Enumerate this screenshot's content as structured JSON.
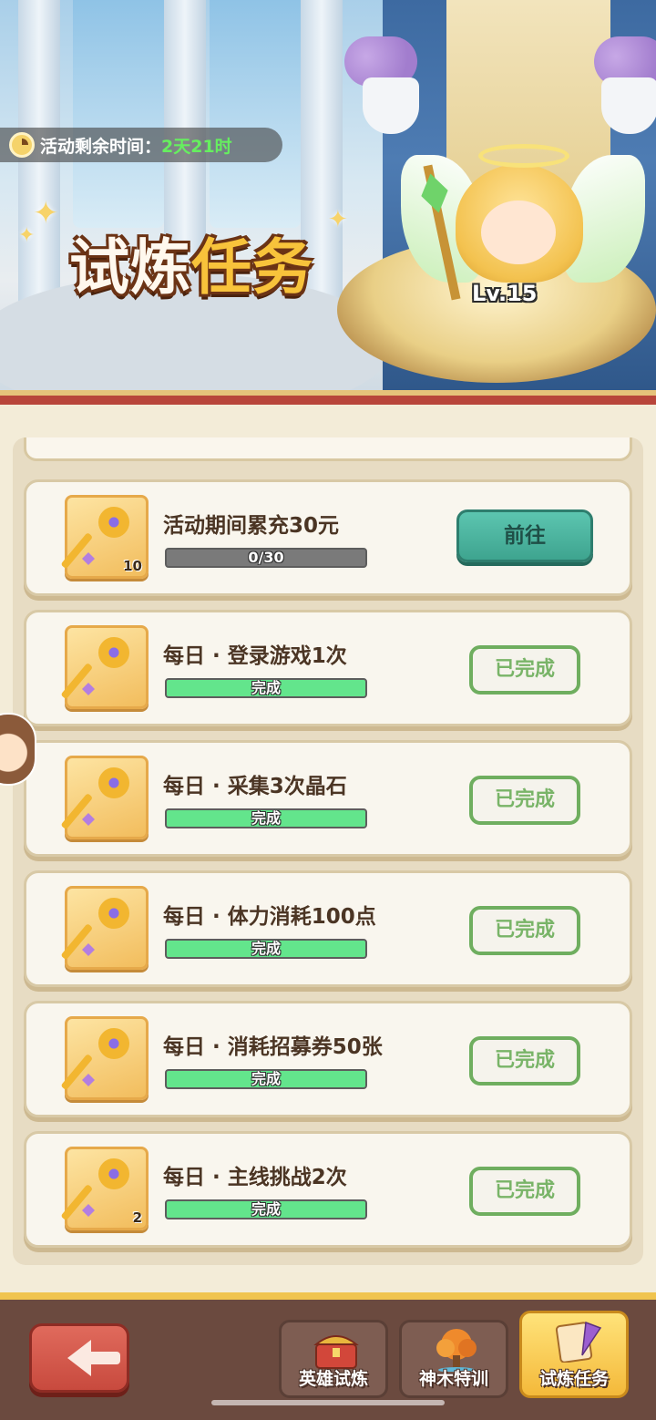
{
  "banner": {
    "timer_label": "活动剩余时间：",
    "timer_value": "2天21时",
    "title_part1": "试炼",
    "title_part2": "任务",
    "hero_level": "Lv.15"
  },
  "tasks": [
    {
      "name": "活动期间累充30元",
      "progress_text": "0/30",
      "progress": 0,
      "count": "10",
      "button": "前往",
      "state": "go"
    },
    {
      "name": "每日 · 登录游戏1次",
      "progress_text": "完成",
      "progress": 1,
      "count": "",
      "button": "已完成",
      "state": "done"
    },
    {
      "name": "每日 · 采集3次晶石",
      "progress_text": "完成",
      "progress": 1,
      "count": "",
      "button": "已完成",
      "state": "done"
    },
    {
      "name": "每日 · 体力消耗100点",
      "progress_text": "完成",
      "progress": 1,
      "count": "",
      "button": "已完成",
      "state": "done"
    },
    {
      "name": "每日 · 消耗招募券50张",
      "progress_text": "完成",
      "progress": 1,
      "count": "",
      "button": "已完成",
      "state": "done"
    },
    {
      "name": "每日 · 主线挑战2次",
      "progress_text": "完成",
      "progress": 1,
      "count": "2",
      "button": "已完成",
      "state": "done"
    }
  ],
  "nav": {
    "tab1": "英雄试炼",
    "tab2": "神木特训",
    "tab3": "试炼任务",
    "active_tab": "tab3"
  },
  "colors": {
    "accent_green": "#63e58c",
    "go_button": "#4cb49f",
    "done_border": "#6fae5f",
    "title_gold": "#f8c33b"
  },
  "icons": [
    "clock-icon",
    "key-icon",
    "back-arrow-icon",
    "treasure-chest-icon",
    "tree-icon",
    "scroll-quill-icon"
  ]
}
